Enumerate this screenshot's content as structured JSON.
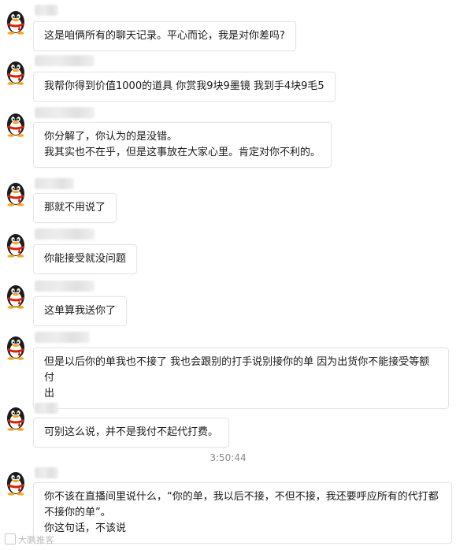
{
  "messages": [
    {
      "text": "这是咱俩所有的聊天记录。平心而论，我是对你差吗?"
    },
    {
      "text": "我帮你得到价值1000的道具 你赏我9块9墨镜 我到手4块9毛5"
    },
    {
      "text": "你分解了，你认为的是没错。\n我其实也不在乎，但是这事放在大家心里。肯定对你不利的。"
    },
    {
      "text": "那就不用说了"
    },
    {
      "text": "你能接受就没问题"
    },
    {
      "text": "这单算我送你了"
    },
    {
      "text": "但是以后你的单我也不接了 我也会跟别的打手说别接你的单 因为出货你不能接受等额付\n出"
    },
    {
      "text": "可别这么说，并不是我付不起代打费。"
    },
    {
      "text": "你不该在直播间里说什么，“你的单，我以后不接，不但不接，我还要呼应所有的代打都\n不接你的单”。\n你这句话，不该说"
    }
  ],
  "timestamp": "3:50:44",
  "watermark": "大鹏推客",
  "avatar_icon": "qq-penguin-icon",
  "colors": {
    "bubble_border": "#e6e6e6",
    "text": "#1a1a1a",
    "time": "#8a8a8a",
    "scarf": "#d81e06"
  }
}
